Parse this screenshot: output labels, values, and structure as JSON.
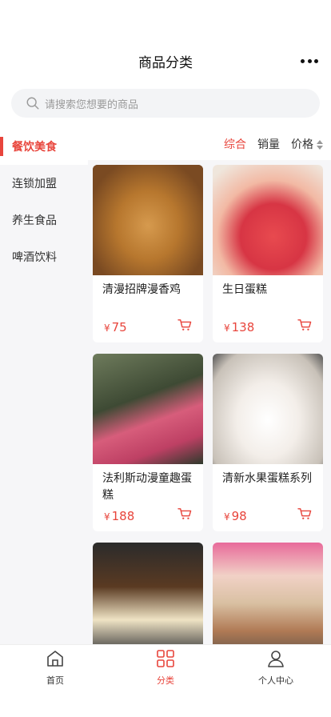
{
  "header": {
    "title": "商品分类"
  },
  "search": {
    "placeholder": "请搜索您想要的商品"
  },
  "sidebar": {
    "items": [
      {
        "label": "餐饮美食",
        "active": true
      },
      {
        "label": "连锁加盟",
        "active": false
      },
      {
        "label": "养生食品",
        "active": false
      },
      {
        "label": "啤酒饮料",
        "active": false
      }
    ]
  },
  "sort": {
    "comprehensive": "综合",
    "sales": "销量",
    "price": "价格"
  },
  "products": [
    {
      "name": "清漫招牌漫香鸡",
      "currency": "¥",
      "price": "75"
    },
    {
      "name": "生日蛋糕",
      "currency": "¥",
      "price": "138"
    },
    {
      "name": "法利斯动漫童趣蛋糕",
      "currency": "¥",
      "price": "188"
    },
    {
      "name": "清新水果蛋糕系列",
      "currency": "¥",
      "price": "98"
    },
    {
      "name": "",
      "currency": "",
      "price": ""
    },
    {
      "name": "",
      "currency": "",
      "price": ""
    }
  ],
  "tabbar": {
    "home": "首页",
    "category": "分类",
    "profile": "个人中心"
  },
  "colors": {
    "accent": "#e8453c",
    "background": "#f6f6f8"
  }
}
